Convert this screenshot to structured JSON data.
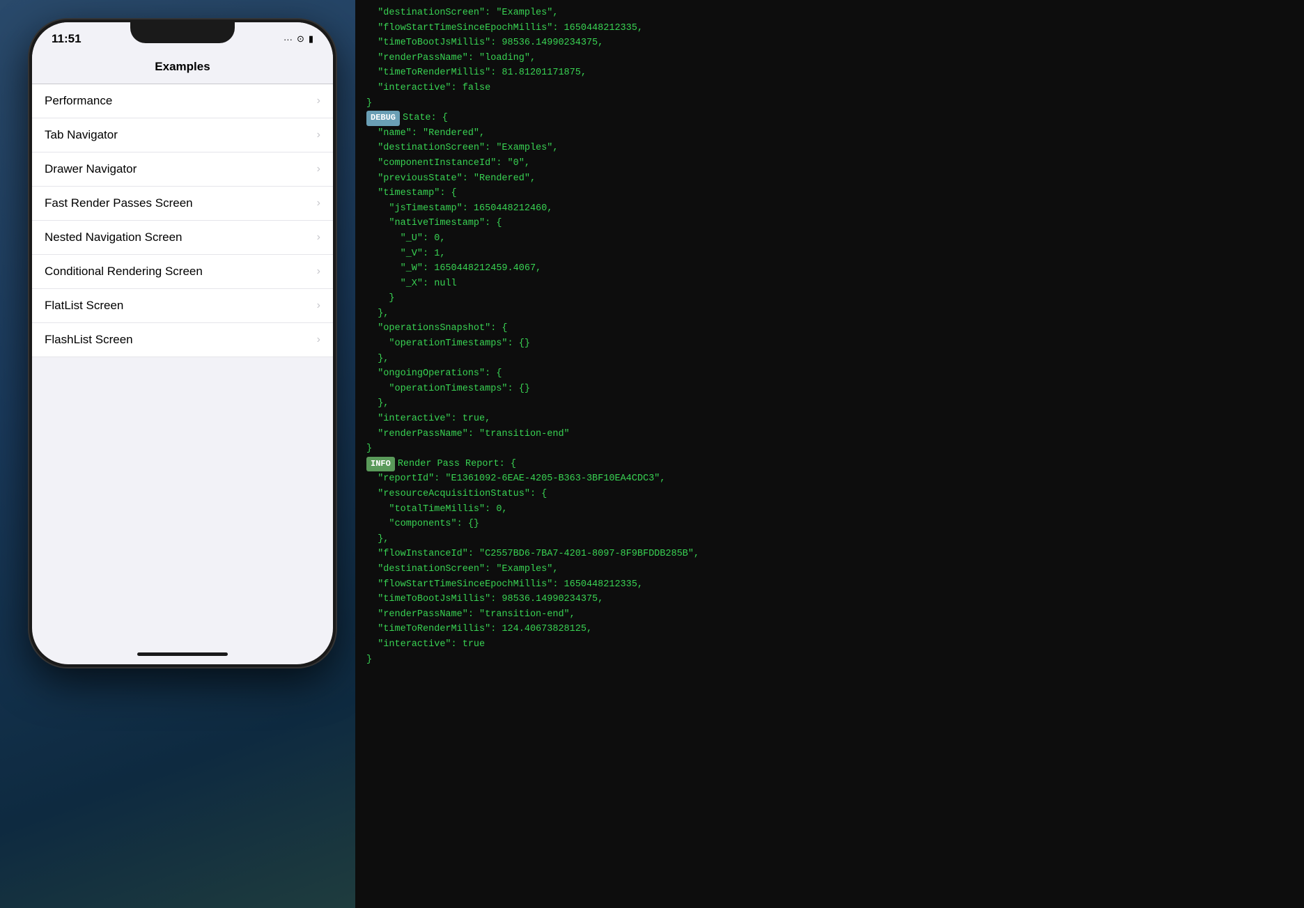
{
  "background": {
    "color": "#2a4a6b"
  },
  "phone": {
    "statusBar": {
      "time": "11:51",
      "icons": "... ⊙ ▮"
    },
    "header": {
      "title": "Examples"
    },
    "menuItems": [
      {
        "label": "Performance",
        "id": "performance"
      },
      {
        "label": "Tab Navigator",
        "id": "tab-navigator"
      },
      {
        "label": "Drawer Navigator",
        "id": "drawer-navigator"
      },
      {
        "label": "Fast Render Passes Screen",
        "id": "fast-render"
      },
      {
        "label": "Nested Navigation Screen",
        "id": "nested-navigation"
      },
      {
        "label": "Conditional Rendering Screen",
        "id": "conditional-rendering"
      },
      {
        "label": "FlatList Screen",
        "id": "flatlist"
      },
      {
        "label": "FlashList Screen",
        "id": "flashlist"
      }
    ],
    "chevron": "›"
  },
  "debugConsole": {
    "lines": [
      {
        "type": "code",
        "text": "  \"destinationScreen\": \"Examples\","
      },
      {
        "type": "code",
        "text": "  \"flowStartTimeSinceEpochMillis\": 1650448212335,"
      },
      {
        "type": "code",
        "text": "  \"timeToBootJsMillis\": 98536.14990234375,"
      },
      {
        "type": "code",
        "text": "  \"renderPassName\": \"loading\","
      },
      {
        "type": "code",
        "text": "  \"timeToRenderMillis\": 81.81201171875,"
      },
      {
        "type": "code",
        "text": "  \"interactive\": false"
      },
      {
        "type": "code",
        "text": "}"
      },
      {
        "type": "badge-line",
        "badge": "DEBUG",
        "badgeType": "debug",
        "text": " State: {"
      },
      {
        "type": "code",
        "text": "  \"name\": \"Rendered\","
      },
      {
        "type": "code",
        "text": "  \"destinationScreen\": \"Examples\","
      },
      {
        "type": "code",
        "text": "  \"componentInstanceId\": \"0\","
      },
      {
        "type": "code",
        "text": "  \"previousState\": \"Rendered\","
      },
      {
        "type": "code",
        "text": "  \"timestamp\": {"
      },
      {
        "type": "code",
        "text": "    \"jsTimestamp\": 1650448212460,"
      },
      {
        "type": "code",
        "text": "    \"nativeTimestamp\": {"
      },
      {
        "type": "code",
        "text": "      \"_U\": 0,"
      },
      {
        "type": "code",
        "text": "      \"_V\": 1,"
      },
      {
        "type": "code",
        "text": "      \"_W\": 1650448212459.4067,"
      },
      {
        "type": "code",
        "text": "      \"_X\": null"
      },
      {
        "type": "code",
        "text": "    }"
      },
      {
        "type": "code",
        "text": "  },"
      },
      {
        "type": "code",
        "text": "  \"operationsSnapshot\": {"
      },
      {
        "type": "code",
        "text": "    \"operationTimestamps\": {}"
      },
      {
        "type": "code",
        "text": "  },"
      },
      {
        "type": "code",
        "text": "  \"ongoingOperations\": {"
      },
      {
        "type": "code",
        "text": "    \"operationTimestamps\": {}"
      },
      {
        "type": "code",
        "text": "  },"
      },
      {
        "type": "code",
        "text": "  \"interactive\": true,"
      },
      {
        "type": "code",
        "text": "  \"renderPassName\": \"transition-end\""
      },
      {
        "type": "code",
        "text": "}"
      },
      {
        "type": "badge-line",
        "badge": "INFO",
        "badgeType": "info",
        "text": " Render Pass Report: {"
      },
      {
        "type": "code",
        "text": "  \"reportId\": \"E1361092-6EAE-4205-B363-3BF10EA4CDC3\","
      },
      {
        "type": "code",
        "text": "  \"resourceAcquisitionStatus\": {"
      },
      {
        "type": "code",
        "text": "    \"totalTimeMillis\": 0,"
      },
      {
        "type": "code",
        "text": "    \"components\": {}"
      },
      {
        "type": "code",
        "text": "  },"
      },
      {
        "type": "code",
        "text": "  \"flowInstanceId\": \"C2557BD6-7BA7-4201-8097-8F9BFDDB285B\","
      },
      {
        "type": "code",
        "text": "  \"destinationScreen\": \"Examples\","
      },
      {
        "type": "code",
        "text": "  \"flowStartTimeSinceEpochMillis\": 1650448212335,"
      },
      {
        "type": "code",
        "text": "  \"timeToBootJsMillis\": 98536.14990234375,"
      },
      {
        "type": "code",
        "text": "  \"renderPassName\": \"transition-end\","
      },
      {
        "type": "code",
        "text": "  \"timeToRenderMillis\": 124.40673828125,"
      },
      {
        "type": "code",
        "text": "  \"interactive\": true"
      },
      {
        "type": "code",
        "text": "}"
      }
    ]
  }
}
